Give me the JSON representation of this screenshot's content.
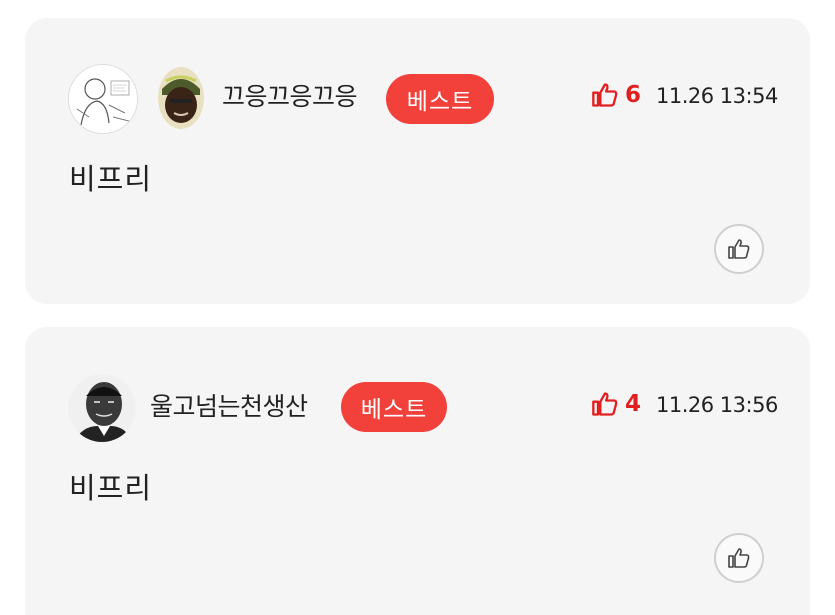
{
  "comments": [
    {
      "nickname": "끄응끄응끄응",
      "badge": "베스트",
      "like_count": "6",
      "timestamp": "11.26 13:54",
      "text": "비프리",
      "avatar_icon": "sketch-avatar-icon",
      "level_icon": "character-avatar-icon"
    },
    {
      "nickname": "울고넘는천생산",
      "badge": "베스트",
      "like_count": "4",
      "timestamp": "11.26 13:56",
      "text": "비프리",
      "avatar_icon": "portrait-avatar-icon"
    }
  ],
  "colors": {
    "accent": "#f2413b",
    "like": "#e02020",
    "card_bg": "#f5f5f5"
  }
}
